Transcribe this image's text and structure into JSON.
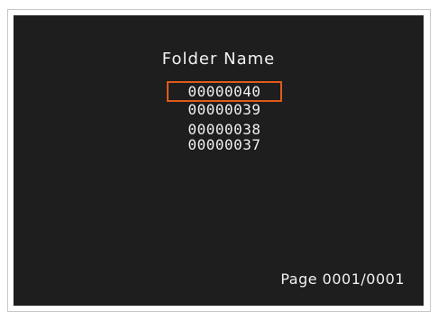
{
  "screen": {
    "title": "Folder Name",
    "folders": [
      {
        "name": "00000040",
        "selected": true
      },
      {
        "name": "00000039",
        "selected": false
      },
      {
        "name": "00000038",
        "selected": false
      },
      {
        "name": "00000037",
        "selected": false
      }
    ],
    "page_indicator": "Page 0001/0001",
    "colors": {
      "background": "#1e1e1e",
      "text": "#f0f0f0",
      "selection_border": "#e05a1a"
    }
  }
}
